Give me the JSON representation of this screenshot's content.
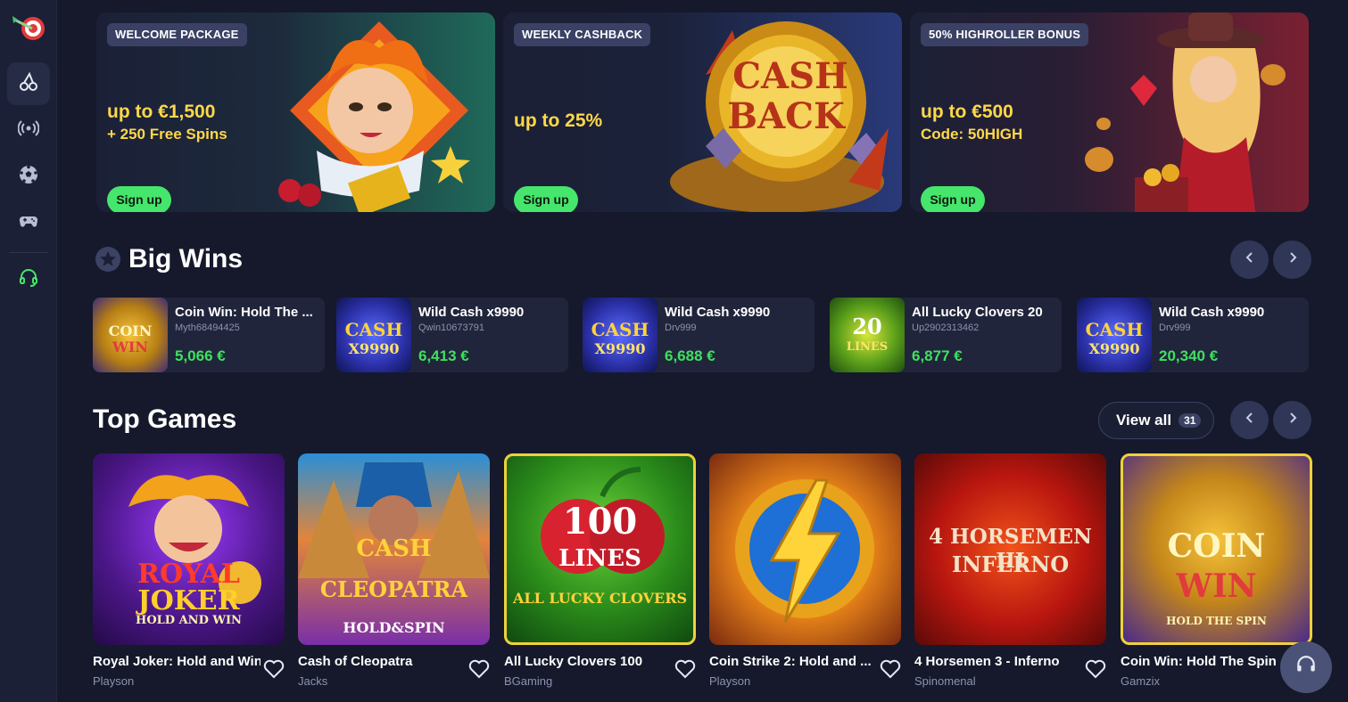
{
  "sidebar": {
    "items": [
      {
        "icon": "cherry-icon",
        "active": true
      },
      {
        "icon": "live-broadcast-icon",
        "active": false
      },
      {
        "icon": "soccer-ball-icon",
        "active": false
      },
      {
        "icon": "gamepad-icon",
        "active": false
      },
      {
        "icon": "support-headset-icon",
        "active": false
      }
    ]
  },
  "promos": [
    {
      "badge": "WELCOME PACKAGE",
      "headline": "up to €1,500",
      "sub": "+ 250 Free Spins",
      "cta": "Sign up"
    },
    {
      "badge": "WEEKLY CASHBACK",
      "headline": "up to 25%",
      "sub": "",
      "cta": "Sign up",
      "art_text_1": "CASH",
      "art_text_2": "BACK"
    },
    {
      "badge": "50% HIGHROLLER BONUS",
      "headline": "up to €500",
      "sub": "Code: 50HIGH",
      "cta": "Sign up"
    }
  ],
  "big_wins": {
    "title": "Big Wins",
    "items": [
      {
        "game": "Coin Win: Hold The ...",
        "user": "Myth68494425",
        "amount": "5,066 €",
        "thumb_l1": "COIN",
        "thumb_l2": "WIN"
      },
      {
        "game": "Wild Cash x9990",
        "user": "Qwin10673791",
        "amount": "6,413 €",
        "thumb_l1": "CASH",
        "thumb_l2": "X9990"
      },
      {
        "game": "Wild Cash x9990",
        "user": "Drv999",
        "amount": "6,688 €",
        "thumb_l1": "CASH",
        "thumb_l2": "X9990"
      },
      {
        "game": "All Lucky Clovers 20",
        "user": "Up2902313462",
        "amount": "6,877 €",
        "thumb_l1": "20",
        "thumb_l2": "LINES"
      },
      {
        "game": "Wild Cash x9990",
        "user": "Drv999",
        "amount": "20,340 €",
        "thumb_l1": "CASH",
        "thumb_l2": "X9990"
      }
    ]
  },
  "top_games": {
    "title": "Top Games",
    "view_all": "View all",
    "count": "31",
    "items": [
      {
        "title": "Royal Joker: Hold and Win",
        "provider": "Playson",
        "tile_l1": "ROYAL",
        "tile_l2": "JOKER",
        "tile_l3": "HOLD AND WIN"
      },
      {
        "title": "Cash of Cleopatra",
        "provider": "Jacks",
        "tile_l1": "CASH",
        "tile_l2": "CLEOPATRA",
        "tile_l3": "HOLD&SPIN"
      },
      {
        "title": "All Lucky Clovers 100",
        "provider": "BGaming",
        "tile_l1": "100",
        "tile_l2": "LINES",
        "tile_l3": "ALL LUCKY CLOVERS"
      },
      {
        "title": "Coin Strike 2: Hold and ...",
        "provider": "Playson",
        "tile_l1": "",
        "tile_l2": "",
        "tile_l3": ""
      },
      {
        "title": "4 Horsemen 3 - Inferno",
        "provider": "Spinomenal",
        "tile_l1": "4 HORSEMEN III",
        "tile_l2": "INFERNO",
        "tile_l3": ""
      },
      {
        "title": "Coin Win: Hold The Spin",
        "provider": "Gamzix",
        "tile_l1": "COIN",
        "tile_l2": "WIN",
        "tile_l3": "HOLD THE SPIN"
      }
    ]
  },
  "colors": {
    "accent_green": "#46e56b",
    "win_green": "#3fe05f",
    "promo_yellow": "#ffd84a",
    "bg": "#15192b"
  }
}
